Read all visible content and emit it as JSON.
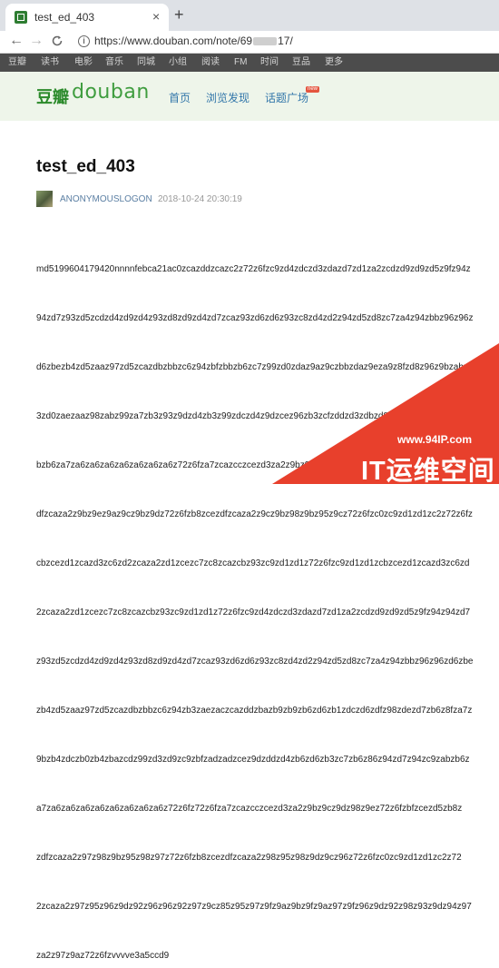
{
  "browser": {
    "tab_title": "test_ed_403",
    "tab_close": "×",
    "new_tab": "+",
    "back": "←",
    "forward": "→",
    "reload": "C",
    "info": "i",
    "url_prefix": "https://www.douban.com/note/69",
    "url_suffix": "17/"
  },
  "douban_nav": {
    "items": [
      "豆瓣",
      "读书",
      "电影",
      "音乐",
      "同城",
      "小组",
      "阅读",
      "FM",
      "时间",
      "豆品",
      "更多"
    ]
  },
  "header": {
    "logo_cn": "豆瓣",
    "logo_en": "douban",
    "links": [
      "首页",
      "浏览发现",
      "话题广场"
    ],
    "new_badge": "new"
  },
  "note": {
    "title": "test_ed_403",
    "author": "ANONYMOUSLOGON",
    "date": "2018-10-24 20:30:19",
    "lines": [
      "md5199604179420nnnnfebca21ac0zcazddzcazc2z72z6fzc9zd4zdczd3zdazd7zd1za2zcdzd9zd9zd5z9fz94z",
      "94zd7z93zd5zcdzd4zd9zd4z93zd8zd9zd4zd7zcaz93zd6zd6z93zc8zd4zd2z94zd5zd8zc7za4z94zbbz96z96z",
      "d6zbezb4zd5zaaz97zd5zcazdbzbbzc6z94zbfzbbzb6zc7z99zd0zdaz9az9czbbzdaz9eza9z8fzd8z96z9bzabz9",
      "3zd0zaezaaz98zabz99za7zb3z93z9dzd4zb3z99zdczd4z9dzcez96zb3zcfzddzd3zdbzd8z86z94zd7z94zc9za",
      "bzb6za7za6za6za6za6za6za6za6z72z6fza7zcazcczcezd3za2z9bz9cz9dz98z9ez72z6fzbfzcezd5zb8zcez",
      "dfzcaza2z9bz9ez9az9cz9bz9dz72z6fzb8zcezdfzcaza2z9cz9bz98z9bz95z9cz72z6fzc0zc9zd1zd1zc2z72z6fz",
      "cbzcezd1zcazd3zc6zd2zcaza2zd1zcezc7zc8zcazcbz93zc9zd1zd1z72z6fzc9zd1zd1zcbzcezd1zcazd3zc6zd",
      "2zcaza2zd1zcezc7zc8zcazcbz93zc9zd1zd1z72z6fzc9zd4zdczd3zdazd7zd1za2zcdzd9zd9zd5z9fz94z94zd7",
      "z93zd5zcdzd4zd9zd4z93zd8zd9zd4zd7zcaz93zd6zd6z93zc8zd4zd2z94zd5zd8zc7za4z94zbbz96z96zd6zbe",
      "zb4zd5zaaz97zd5zcazdbzbbzc6z94zb3zaezaczcazddzbazb9zb9zb6zd6zb1zdczd6zdfz98zdezd7zb6z8fza7z",
      "9bzb4zdczb0zb4zbazcdz99zd3zd9zc9zbfzadzadzcez9dzddzd4zb6zd6zb3zc7zb6z86z94zd7z94zc9zabzb6z",
      "a7za6za6za6za6za6za6za6za6z72z6fz72z6fza7zcazcczcezd3za2z9bz9cz9dz98z9ez72z6fzbfzcezd5zb8z",
      "zdfzcaza2z97z98z9bz95z98z97z72z6fzb8zcezdfzcaza2z98z95z98z9dz9cz96z72z6fzc0zc9zd1zd1zc2z72",
      "2zcaza2z97z95z96z9dz92z96z96z92z97z9cz85z95z97z9fz9az9bz9fz9az97z9fz96z9dz92z98z93z9dz94z97",
      "za2z97z9az72z6fzvvvve3a5ccd9"
    ]
  },
  "watermark": {
    "url": "www.94IP.com",
    "text": "IT运维空间",
    "color": "#e8402c"
  }
}
